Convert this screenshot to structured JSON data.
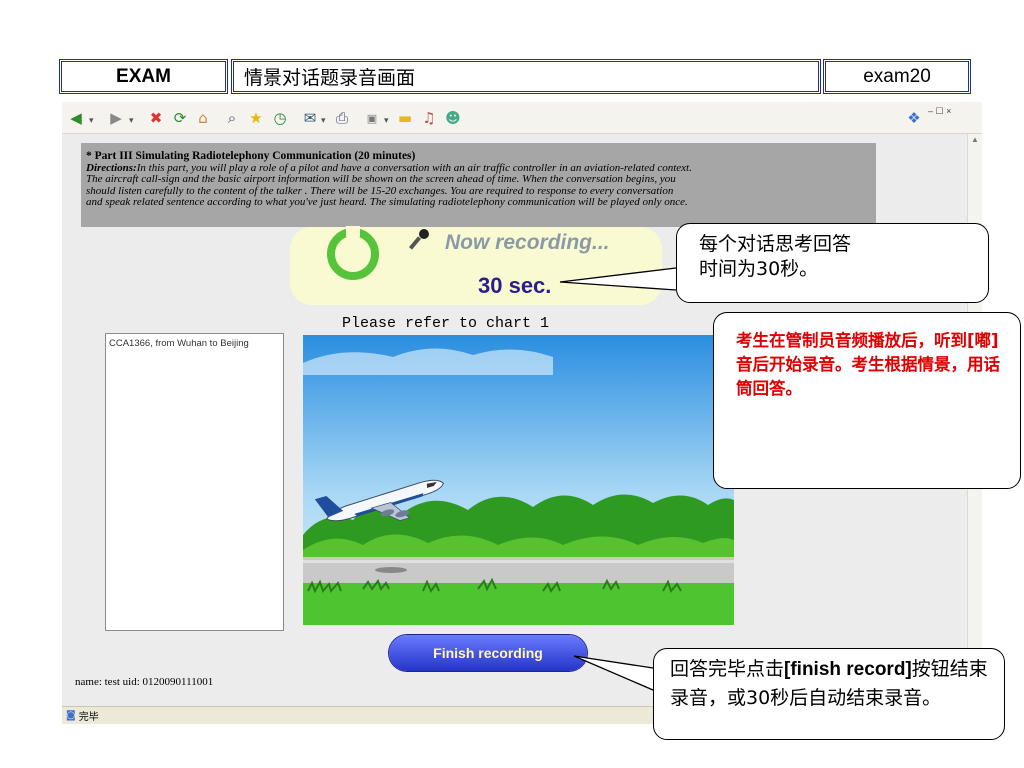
{
  "header": {
    "exam_label": "EXAM",
    "title": "情景对话题录音画面",
    "exam_id": "exam20"
  },
  "toolbar": {
    "icons": [
      "back-icon",
      "forward-icon",
      "stop-icon",
      "refresh-icon",
      "home-icon",
      "search-icon",
      "favorites-icon",
      "history-icon",
      "mail-icon",
      "print-icon",
      "edit-icon",
      "folder-icon",
      "media-icon",
      "messenger-icon"
    ],
    "window_controls": "– ☐ ×"
  },
  "instructions": {
    "title": "Part III  Simulating Radiotelephony Communication (20 minutes)",
    "directions_label": "Directions:",
    "text_line1": "In this part, you will play a role of a pilot and have a conversation with an air traffic controller in an aviation-related context.",
    "text_line2": "The aircraft call-sign and the basic airport information will be shown on the screen ahead of time. When the conversation begins, you",
    "text_line3": "should listen carefully to the content of the talker . There will be 15-20 exchanges. You are required to response to every conversation",
    "text_line4": "and speak related sentence according to what you've just heard. The simulating radiotelephony communication will be played only once."
  },
  "recording": {
    "status": "Now recording...",
    "timer": "30 sec."
  },
  "chart_ref": "Please refer to chart 1",
  "flight_info": "CCA1366, from Wuhan to Beijing",
  "finish_button": "Finish  recording",
  "user_info": "name: test uid: 0120090111001",
  "statusbar": {
    "text": "完毕"
  },
  "callouts": {
    "think_time_line1": "每个对话思考回答",
    "think_time_line2": "时间为30秒。",
    "start_instruction": "考生在管制员音频播放后，听到[嘟] 音后开始录音。考生根据情景，用话筒回答。",
    "finish_text_a": "回答完毕点击",
    "finish_text_bold": "[finish record]",
    "finish_text_b": "按钮结束录音，或30秒后自动结束录音。"
  },
  "colors": {
    "header_border": "#1f2f8f",
    "instruction_bg": "#a6a6a6",
    "recording_panel": "#fafad2",
    "ring_green": "#55c43a",
    "timer_text": "#2a1d8f",
    "button_blue": "#2434c8",
    "callout_red": "#e00000"
  }
}
